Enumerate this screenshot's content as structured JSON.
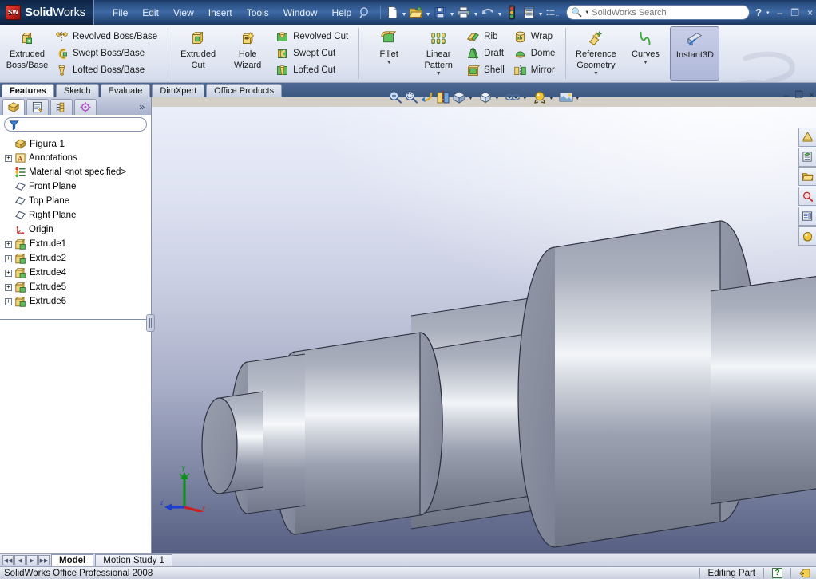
{
  "app": {
    "brand_bold": "Solid",
    "brand_light": "Works",
    "logo_text": "SW",
    "status_product": "SolidWorks Office Professional 2008",
    "status_mode": "Editing Part",
    "accent_blue": "#2c5286",
    "ribbon_bg": "#e6eaf4"
  },
  "menu": {
    "items": [
      {
        "label": "File"
      },
      {
        "label": "Edit"
      },
      {
        "label": "View"
      },
      {
        "label": "Insert"
      },
      {
        "label": "Tools"
      },
      {
        "label": "Window"
      },
      {
        "label": "Help"
      }
    ]
  },
  "quick_access": {
    "tools": [
      {
        "name": "new-document-icon",
        "has_dropdown": true
      },
      {
        "name": "open-document-icon",
        "has_dropdown": true
      },
      {
        "name": "save-icon",
        "has_dropdown": true
      },
      {
        "name": "print-icon",
        "has_dropdown": true
      },
      {
        "name": "undo-icon",
        "has_dropdown": true
      },
      {
        "name": "rebuild-icon",
        "has_dropdown": false
      },
      {
        "name": "options-icon",
        "has_dropdown": true
      },
      {
        "name": "customize-menu-icon",
        "has_dropdown": false
      }
    ]
  },
  "search": {
    "placeholder": "SolidWorks Search",
    "value": ""
  },
  "window_controls": {
    "help": "?",
    "help_dropdown": "▾",
    "minimize": "–",
    "restore": "❐",
    "close": "×"
  },
  "ribbon": {
    "groups": [
      {
        "name": "boss-base-group",
        "big": {
          "label_line1": "Extruded",
          "label_line2": "Boss/Base",
          "icon": "extruded-boss-icon"
        },
        "small": [
          {
            "label": "Revolved Boss/Base",
            "icon": "revolved-boss-icon"
          },
          {
            "label": "Swept Boss/Base",
            "icon": "swept-boss-icon"
          },
          {
            "label": "Lofted Boss/Base",
            "icon": "lofted-boss-icon"
          }
        ]
      },
      {
        "name": "cut-group",
        "big_buttons": [
          {
            "label_line1": "Extruded",
            "label_line2": "Cut",
            "icon": "extruded-cut-icon"
          },
          {
            "label_line1": "Hole",
            "label_line2": "Wizard",
            "icon": "hole-wizard-icon"
          }
        ],
        "small": [
          {
            "label": "Revolved Cut",
            "icon": "revolved-cut-icon"
          },
          {
            "label": "Swept Cut",
            "icon": "swept-cut-icon"
          },
          {
            "label": "Lofted Cut",
            "icon": "lofted-cut-icon"
          }
        ]
      },
      {
        "name": "feature-group",
        "big_buttons": [
          {
            "label_line1": "Fillet",
            "label_line2": "",
            "icon": "fillet-icon",
            "dropdown": true
          },
          {
            "label_line1": "Linear",
            "label_line2": "Pattern",
            "icon": "linear-pattern-icon",
            "dropdown": true
          }
        ],
        "small_a": [
          {
            "label": "Rib",
            "icon": "rib-icon"
          },
          {
            "label": "Draft",
            "icon": "draft-icon"
          },
          {
            "label": "Shell",
            "icon": "shell-icon"
          }
        ],
        "small_b": [
          {
            "label": "Wrap",
            "icon": "wrap-icon"
          },
          {
            "label": "Dome",
            "icon": "dome-icon"
          },
          {
            "label": "Mirror",
            "icon": "mirror-icon"
          }
        ]
      },
      {
        "name": "reference-group",
        "big_buttons": [
          {
            "label_line1": "Reference",
            "label_line2": "Geometry",
            "icon": "reference-geometry-icon",
            "dropdown": true
          },
          {
            "label_line1": "Curves",
            "label_line2": "",
            "icon": "curves-icon",
            "dropdown": true
          },
          {
            "label_line1": "Instant3D",
            "label_line2": "",
            "icon": "instant3d-icon",
            "active": true
          }
        ]
      }
    ]
  },
  "command_tabs": {
    "items": [
      {
        "label": "Features",
        "active": true
      },
      {
        "label": "Sketch",
        "active": false
      },
      {
        "label": "Evaluate",
        "active": false
      },
      {
        "label": "DimXpert",
        "active": false
      },
      {
        "label": "Office Products",
        "active": false
      }
    ]
  },
  "view_toolbar": {
    "items": [
      {
        "name": "zoom-to-fit-icon",
        "dropdown": false
      },
      {
        "name": "zoom-to-area-icon",
        "dropdown": false
      },
      {
        "name": "previous-view-icon",
        "dropdown": false
      },
      {
        "name": "section-view-icon",
        "dropdown": false
      },
      {
        "name": "view-orientation-icon",
        "dropdown": true
      },
      {
        "name": "display-style-icon",
        "dropdown": true
      },
      {
        "name": "hide-show-items-icon",
        "dropdown": true
      },
      {
        "name": "edit-appearance-icon",
        "dropdown": true
      },
      {
        "name": "apply-scene-icon",
        "dropdown": true
      }
    ]
  },
  "feature_manager": {
    "tabs": [
      {
        "name": "feature-manager-tab",
        "active": true
      },
      {
        "name": "property-manager-tab",
        "active": false
      },
      {
        "name": "configuration-manager-tab",
        "active": false
      },
      {
        "name": "dimxpert-manager-tab",
        "active": false
      }
    ],
    "expand_label": "»",
    "filter": {
      "placeholder": "",
      "value": ""
    },
    "tree": [
      {
        "label": "Figura 1",
        "icon": "part-icon",
        "expandable": false,
        "indent": 0,
        "root": true
      },
      {
        "label": "Annotations",
        "icon": "annotations-icon",
        "expandable": true,
        "indent": 1
      },
      {
        "label": "Material <not specified>",
        "icon": "material-icon",
        "expandable": false,
        "indent": 1
      },
      {
        "label": "Front Plane",
        "icon": "plane-icon",
        "expandable": false,
        "indent": 1
      },
      {
        "label": "Top Plane",
        "icon": "plane-icon",
        "expandable": false,
        "indent": 1
      },
      {
        "label": "Right Plane",
        "icon": "plane-icon",
        "expandable": false,
        "indent": 1
      },
      {
        "label": "Origin",
        "icon": "origin-icon",
        "expandable": false,
        "indent": 1
      },
      {
        "label": "Extrude1",
        "icon": "extrude-feature-icon",
        "expandable": true,
        "indent": 1
      },
      {
        "label": "Extrude2",
        "icon": "extrude-feature-icon",
        "expandable": true,
        "indent": 1
      },
      {
        "label": "Extrude4",
        "icon": "extrude-feature-icon",
        "expandable": true,
        "indent": 1
      },
      {
        "label": "Extrude5",
        "icon": "extrude-feature-icon",
        "expandable": true,
        "indent": 1
      },
      {
        "label": "Extrude6",
        "icon": "extrude-feature-icon",
        "expandable": true,
        "indent": 1
      }
    ]
  },
  "task_pane": {
    "buttons": [
      {
        "name": "solidworks-resources-icon"
      },
      {
        "name": "design-library-icon"
      },
      {
        "name": "file-explorer-icon"
      },
      {
        "name": "search-task-icon"
      },
      {
        "name": "view-palette-icon"
      },
      {
        "name": "appearances-scenes-icon"
      }
    ]
  },
  "graphics": {
    "model_name": "stepped-shaft-part",
    "triad": {
      "x_label": "x",
      "y_label": "Y",
      "z_label": "Z",
      "x_color": "#cc1e1e",
      "y_color": "#0f8f1b",
      "z_color": "#1c3fd0"
    },
    "background": {
      "top_color": "#eaeefa",
      "bottom_color": "#565f82"
    },
    "part_color": "#8d93a6"
  },
  "bottom_tabs": {
    "nav": [
      {
        "name": "first-tab-button",
        "glyph": "◀◀"
      },
      {
        "name": "previous-tab-button",
        "glyph": "◀"
      },
      {
        "name": "next-tab-button",
        "glyph": "▶"
      },
      {
        "name": "last-tab-button",
        "glyph": "▶▶"
      }
    ],
    "tabs": [
      {
        "label": "Model",
        "active": true
      },
      {
        "label": "Motion Study 1",
        "active": false
      }
    ]
  }
}
